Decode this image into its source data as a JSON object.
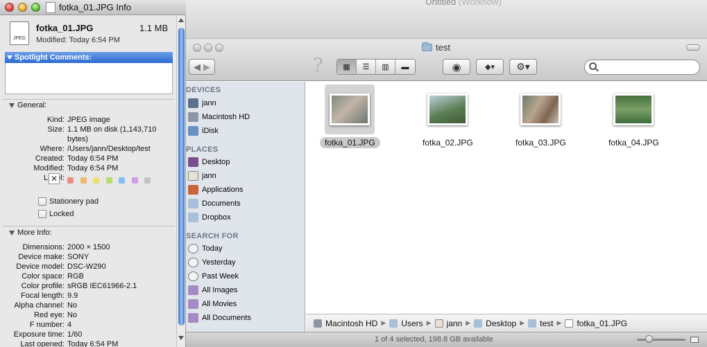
{
  "background_window": {
    "title": "Untitled",
    "title_suffix": "(Workflow)"
  },
  "finder": {
    "title": "test",
    "toolbar": {
      "help_icon": "question-mark-icon",
      "view_modes": [
        "icon-view",
        "list-view",
        "column-view",
        "cover-flow-view"
      ],
      "selected_view": "icon-view",
      "search_placeholder": ""
    },
    "sidebar": {
      "devices_header": "DEVICES",
      "devices": [
        {
          "label": "jann",
          "icon": "computer-icon"
        },
        {
          "label": "Macintosh HD",
          "icon": "hard-drive-icon"
        },
        {
          "label": "iDisk",
          "icon": "idisk-icon"
        }
      ],
      "places_header": "PLACES",
      "places": [
        {
          "label": "Desktop",
          "icon": "desktop-icon"
        },
        {
          "label": "jann",
          "icon": "home-icon"
        },
        {
          "label": "Applications",
          "icon": "applications-icon"
        },
        {
          "label": "Documents",
          "icon": "documents-folder-icon"
        },
        {
          "label": "Dropbox",
          "icon": "dropbox-folder-icon"
        }
      ],
      "search_header": "SEARCH FOR",
      "search_for": [
        {
          "label": "Today",
          "icon": "clock-icon"
        },
        {
          "label": "Yesterday",
          "icon": "clock-icon"
        },
        {
          "label": "Past Week",
          "icon": "clock-icon"
        },
        {
          "label": "All Images",
          "icon": "smart-folder-icon"
        },
        {
          "label": "All Movies",
          "icon": "smart-folder-icon"
        },
        {
          "label": "All Documents",
          "icon": "smart-folder-icon"
        }
      ]
    },
    "files": [
      {
        "name": "fotka_01.JPG",
        "selected": true
      },
      {
        "name": "fotka_02.JPG",
        "selected": false
      },
      {
        "name": "fotka_03.JPG",
        "selected": false
      },
      {
        "name": "fotka_04.JPG",
        "selected": false
      }
    ],
    "path_bar": [
      "Macintosh HD",
      "Users",
      "jann",
      "Desktop",
      "test",
      "fotka_01.JPG"
    ],
    "status": "1 of 4 selected, 198.8 GB available"
  },
  "info": {
    "window_title": "fotka_01.JPG Info",
    "file_name": "fotka_01.JPG",
    "file_size": "1.1 MB",
    "modified_line": "Modified: Today 6:54 PM",
    "icon_label": "JPEG",
    "spotlight_header": "Spotlight Comments:",
    "general_header": "General:",
    "general": [
      {
        "k": "Kind:",
        "v": "JPEG image"
      },
      {
        "k": "Size:",
        "v": "1.1 MB on disk (1,143,710"
      },
      {
        "k": "",
        "v": "bytes)"
      },
      {
        "k": "Where:",
        "v": "/Users/jann/Desktop/test"
      },
      {
        "k": "Created:",
        "v": "Today 6:54 PM"
      },
      {
        "k": "Modified:",
        "v": "Today 6:54 PM"
      }
    ],
    "label_key": "Label:",
    "label_colors": [
      "#f08a86",
      "#f3b76f",
      "#eddd6b",
      "#b6de6f",
      "#84c0ef",
      "#d49be6",
      "#c4c4c4"
    ],
    "stationery_label": "Stationery pad",
    "locked_label": "Locked",
    "more_info_header": "More Info:",
    "more_info": [
      {
        "k": "Dimensions:",
        "v": "2000 × 1500"
      },
      {
        "k": "Device make:",
        "v": "SONY"
      },
      {
        "k": "Device model:",
        "v": "DSC-W290"
      },
      {
        "k": "Color space:",
        "v": "RGB"
      },
      {
        "k": "Color profile:",
        "v": "sRGB IEC61966-2.1"
      },
      {
        "k": "Focal length:",
        "v": "9.9"
      },
      {
        "k": "Alpha channel:",
        "v": "No"
      },
      {
        "k": "Red eye:",
        "v": "No"
      },
      {
        "k": "F number:",
        "v": "4"
      },
      {
        "k": "Exposure time:",
        "v": "1/60"
      },
      {
        "k": "Last opened:",
        "v": "Today 6:54 PM"
      }
    ]
  }
}
